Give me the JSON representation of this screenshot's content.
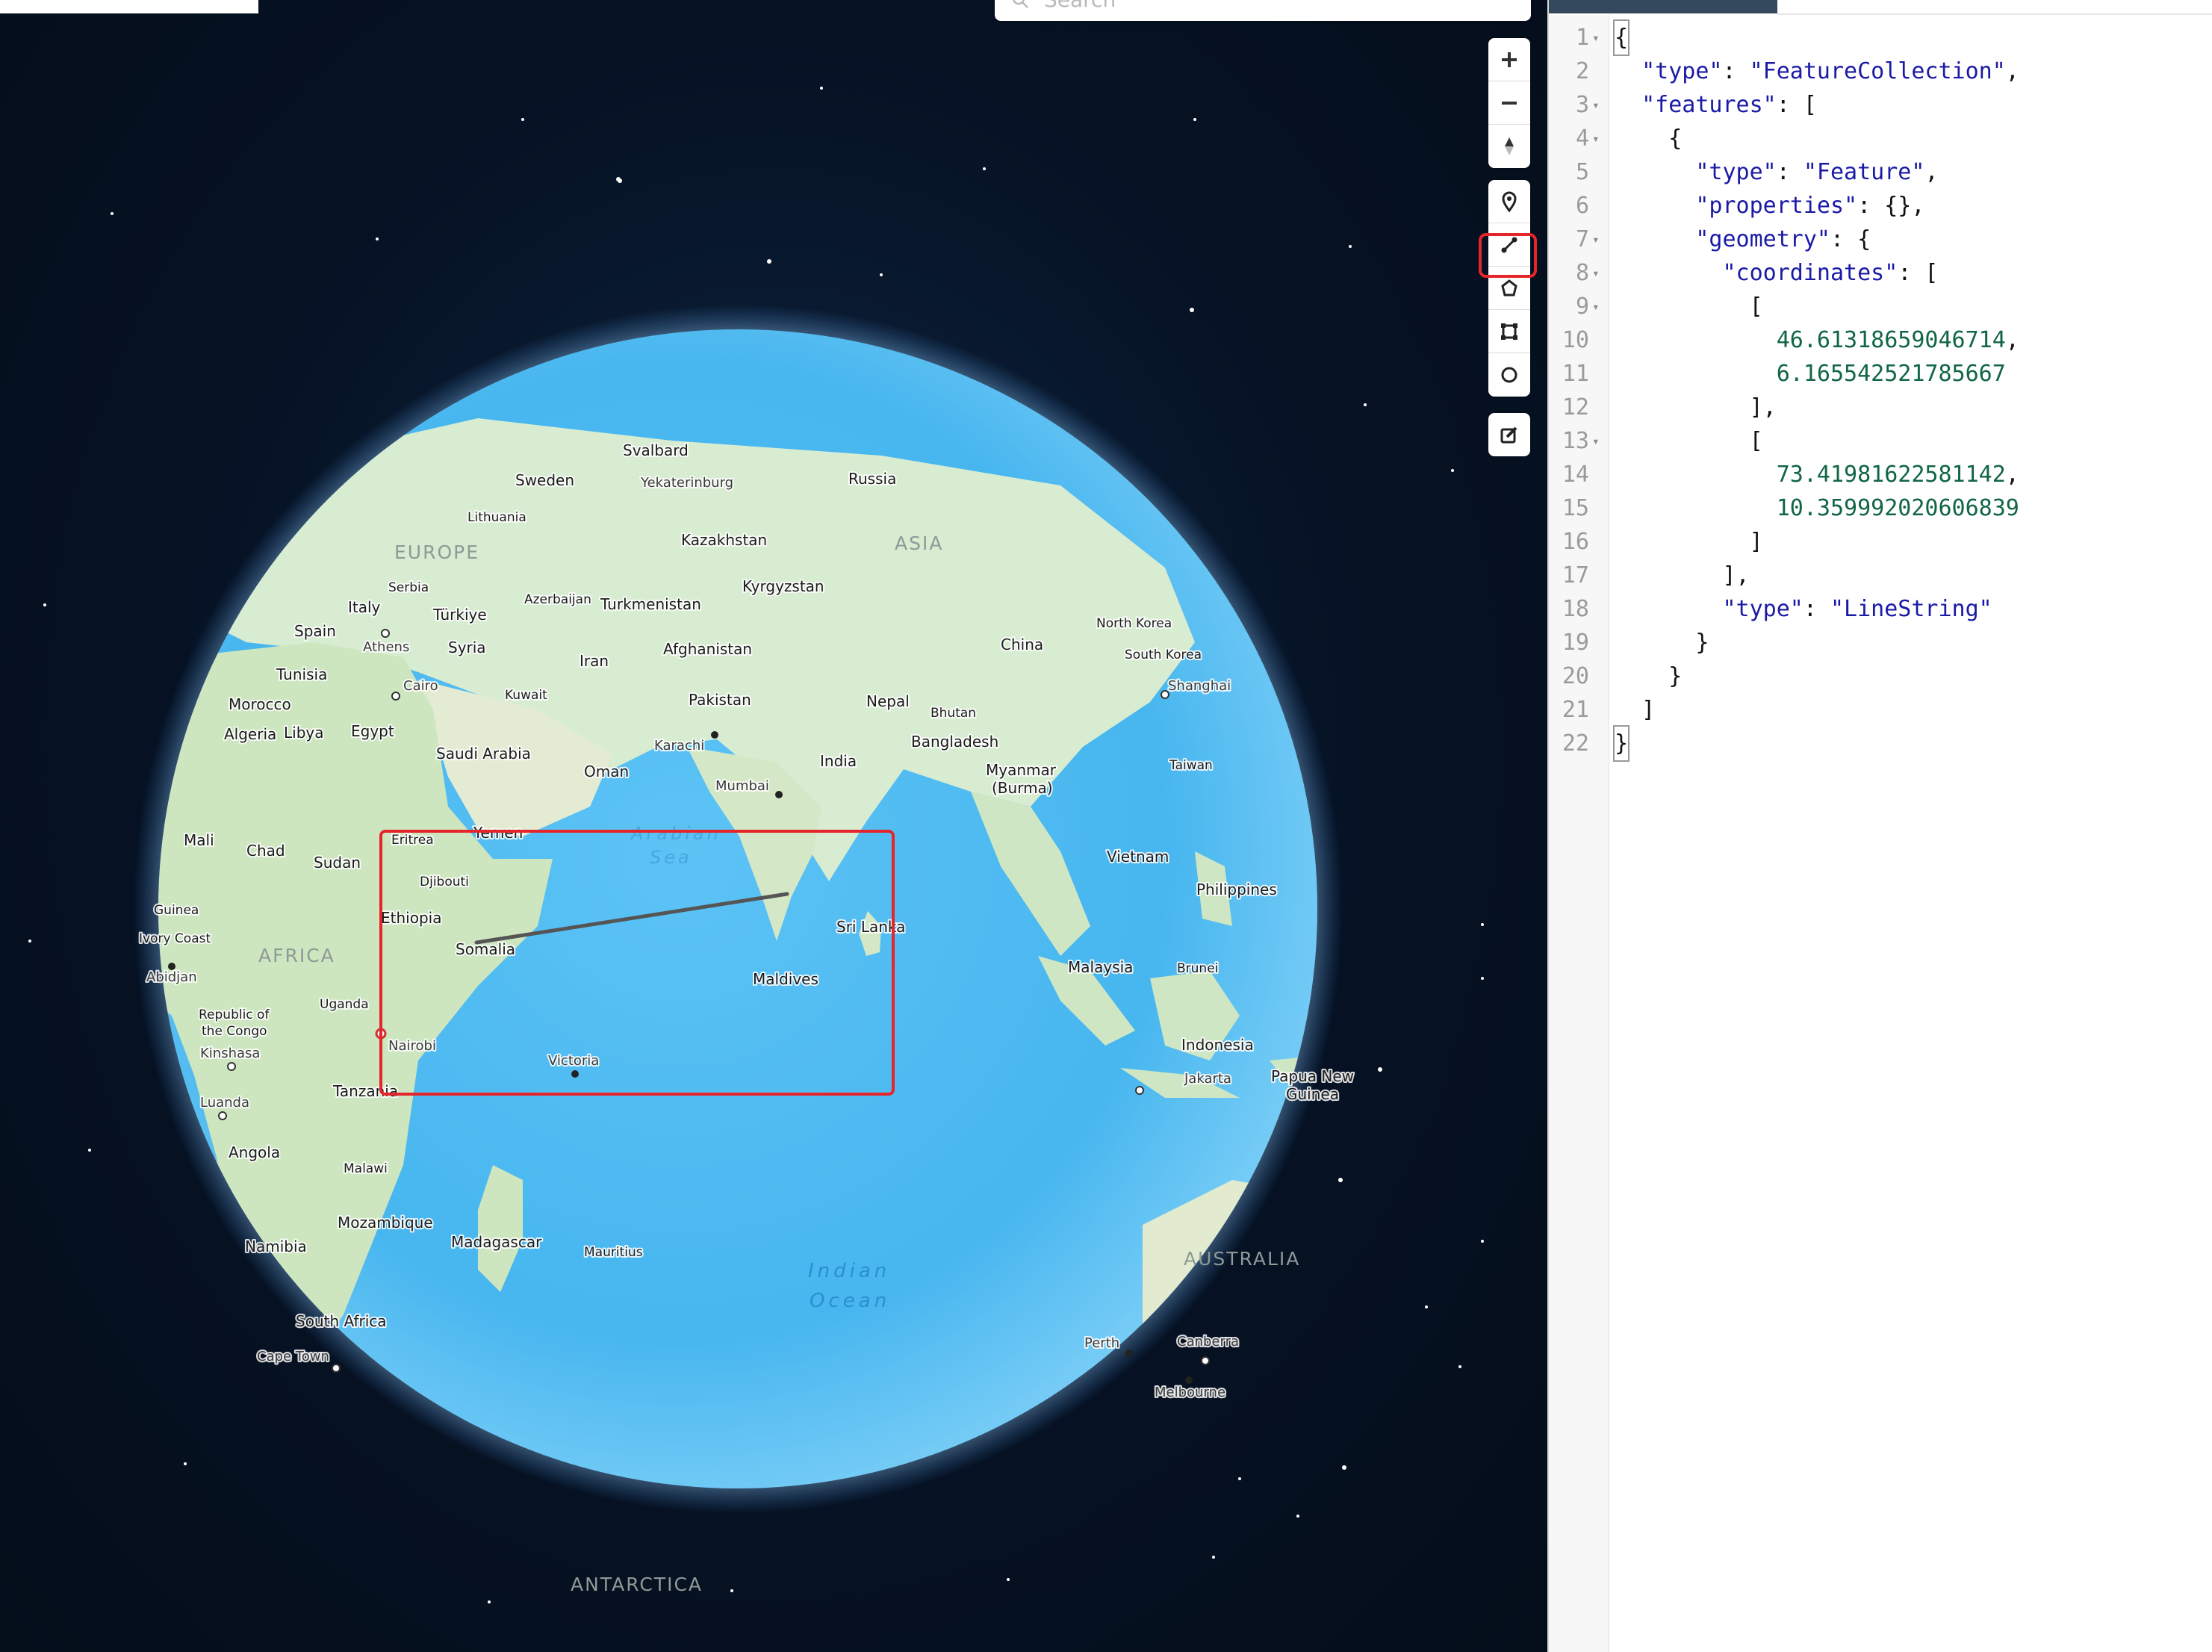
{
  "search": {
    "placeholder": "Search"
  },
  "map": {
    "regions": {
      "europe": "EUROPE",
      "asia": "ASIA",
      "africa": "AFRICA",
      "australia": "AUSTRALIA",
      "antarctica": "ANTARCTICA"
    },
    "seas": {
      "arabian_1": "Arabian",
      "arabian_2": "Sea",
      "indian_1": "Indian",
      "indian_2": "Ocean"
    },
    "countries": {
      "svalbard": "Svalbard",
      "sweden": "Sweden",
      "russia": "Russia",
      "lithuania": "Lithuania",
      "kazakhstan": "Kazakhstan",
      "serbia": "Serbia",
      "italy": "Italy",
      "turkiye": "Türkiye",
      "azerbaijan": "Azerbaijan",
      "kyrgyzstan": "Kyrgyzstan",
      "turkmenistan": "Turkmenistan",
      "spain": "Spain",
      "syria": "Syria",
      "north_korea": "North Korea",
      "south_korea": "South Korea",
      "tunisia": "Tunisia",
      "iran": "Iran",
      "afghanistan": "Afghanistan",
      "china": "China",
      "morocco": "Morocco",
      "kuwait": "Kuwait",
      "pakistan": "Pakistan",
      "nepal": "Nepal",
      "bhutan": "Bhutan",
      "algeria": "Algeria",
      "libya": "Libya",
      "egypt": "Egypt",
      "saudi_arabia": "Saudi Arabia",
      "bangladesh": "Bangladesh",
      "oman": "Oman",
      "india": "India",
      "myanmar_1": "Myanmar",
      "myanmar_2": "(Burma)",
      "taiwan": "Taiwan",
      "mali": "Mali",
      "chad": "Chad",
      "eritrea": "Eritrea",
      "yemen": "Yemen",
      "sudan": "Sudan",
      "vietnam": "Vietnam",
      "djibouti": "Djibouti",
      "philippines": "Philippines",
      "guinea": "Guinea",
      "ethiopia": "Ethiopia",
      "sri_lanka": "Sri Lanka",
      "ivory_coast": "Ivory Coast",
      "somalia": "Somalia",
      "maldives": "Maldives",
      "malaysia": "Malaysia",
      "brunei": "Brunei",
      "uganda": "Uganda",
      "roc_1": "Republic of",
      "roc_2": "the Congo",
      "indonesia": "Indonesia",
      "tanzania": "Tanzania",
      "papua_1": "Papua New",
      "papua_2": "Guinea",
      "angola": "Angola",
      "malawi": "Malawi",
      "mozambique": "Mozambique",
      "madagascar": "Madagascar",
      "mauritius": "Mauritius",
      "namibia": "Namibia",
      "south_africa": "South Africa"
    },
    "cities": {
      "yekaterinburg": "Yekaterinburg",
      "athens": "Athens",
      "cairo": "Cairo",
      "shanghai": "Shanghai",
      "karachi": "Karachi",
      "mumbai": "Mumbai",
      "abidjan": "Abidjan",
      "kinshasa": "Kinshasa",
      "nairobi": "Nairobi",
      "victoria": "Victoria",
      "jakarta": "Jakarta",
      "luanda": "Luanda",
      "cape_town": "Cape Town",
      "perth": "Perth",
      "canberra": "Canberra",
      "melbourne": "Melbourne"
    }
  },
  "controls": {
    "zoom_in": "zoom-in",
    "zoom_out": "zoom-out",
    "compass": "compass",
    "draw_point": "marker",
    "draw_line": "line",
    "draw_polygon": "polygon",
    "draw_rectangle": "rectangle",
    "draw_circle": "circle",
    "edit": "edit"
  },
  "editor": {
    "lines": [
      {
        "n": "1",
        "fold": "▾",
        "text": "{"
      },
      {
        "n": "2",
        "fold": "",
        "text": "  \"type\": \"FeatureCollection\","
      },
      {
        "n": "3",
        "fold": "▾",
        "text": "  \"features\": ["
      },
      {
        "n": "4",
        "fold": "▾",
        "text": "    {"
      },
      {
        "n": "5",
        "fold": "",
        "text": "      \"type\": \"Feature\","
      },
      {
        "n": "6",
        "fold": "",
        "text": "      \"properties\": {},"
      },
      {
        "n": "7",
        "fold": "▾",
        "text": "      \"geometry\": {"
      },
      {
        "n": "8",
        "fold": "▾",
        "text": "        \"coordinates\": ["
      },
      {
        "n": "9",
        "fold": "▾",
        "text": "          ["
      },
      {
        "n": "10",
        "fold": "",
        "text": "            46.61318659046714,"
      },
      {
        "n": "11",
        "fold": "",
        "text": "            6.165542521785667"
      },
      {
        "n": "12",
        "fold": "",
        "text": "          ],"
      },
      {
        "n": "13",
        "fold": "▾",
        "text": "          ["
      },
      {
        "n": "14",
        "fold": "",
        "text": "            73.41981622581142,"
      },
      {
        "n": "15",
        "fold": "",
        "text": "            10.359992020606839"
      },
      {
        "n": "16",
        "fold": "",
        "text": "          ]"
      },
      {
        "n": "17",
        "fold": "",
        "text": "        ],"
      },
      {
        "n": "18",
        "fold": "",
        "text": "        \"type\": \"LineString\""
      },
      {
        "n": "19",
        "fold": "",
        "text": "      }"
      },
      {
        "n": "20",
        "fold": "",
        "text": "    }"
      },
      {
        "n": "21",
        "fold": "",
        "text": "  ]"
      },
      {
        "n": "22",
        "fold": "",
        "text": "}"
      }
    ]
  }
}
